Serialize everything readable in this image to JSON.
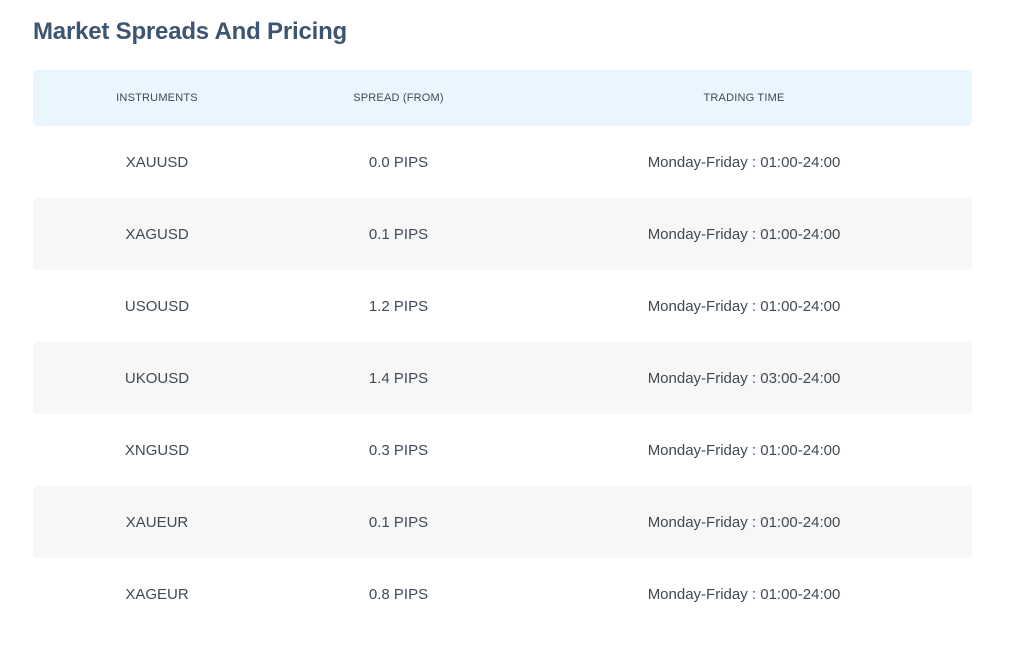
{
  "title": "Market Spreads And Pricing",
  "table": {
    "headers": {
      "instruments": "INSTRUMENTS",
      "spread": "SPREAD (FROM)",
      "trading_time": "TRADING TIME"
    },
    "rows": [
      {
        "instrument": "XAUUSD",
        "spread": "0.0 PIPS",
        "time": "Monday-Friday : 01:00-24:00"
      },
      {
        "instrument": "XAGUSD",
        "spread": "0.1 PIPS",
        "time": "Monday-Friday : 01:00-24:00"
      },
      {
        "instrument": "USOUSD",
        "spread": "1.2 PIPS",
        "time": "Monday-Friday : 01:00-24:00"
      },
      {
        "instrument": "UKOUSD",
        "spread": "1.4 PIPS",
        "time": "Monday-Friday : 03:00-24:00"
      },
      {
        "instrument": "XNGUSD",
        "spread": "0.3 PIPS",
        "time": "Monday-Friday : 01:00-24:00"
      },
      {
        "instrument": "XAUEUR",
        "spread": "0.1 PIPS",
        "time": "Monday-Friday : 01:00-24:00"
      },
      {
        "instrument": "XAGEUR",
        "spread": "0.8 PIPS",
        "time": "Monday-Friday : 01:00-24:00"
      }
    ]
  },
  "colors": {
    "title": "#3d5570",
    "header_background": "#eaf6fd",
    "alt_row_background": "#f7f7f7",
    "text": "#3f4a55"
  }
}
